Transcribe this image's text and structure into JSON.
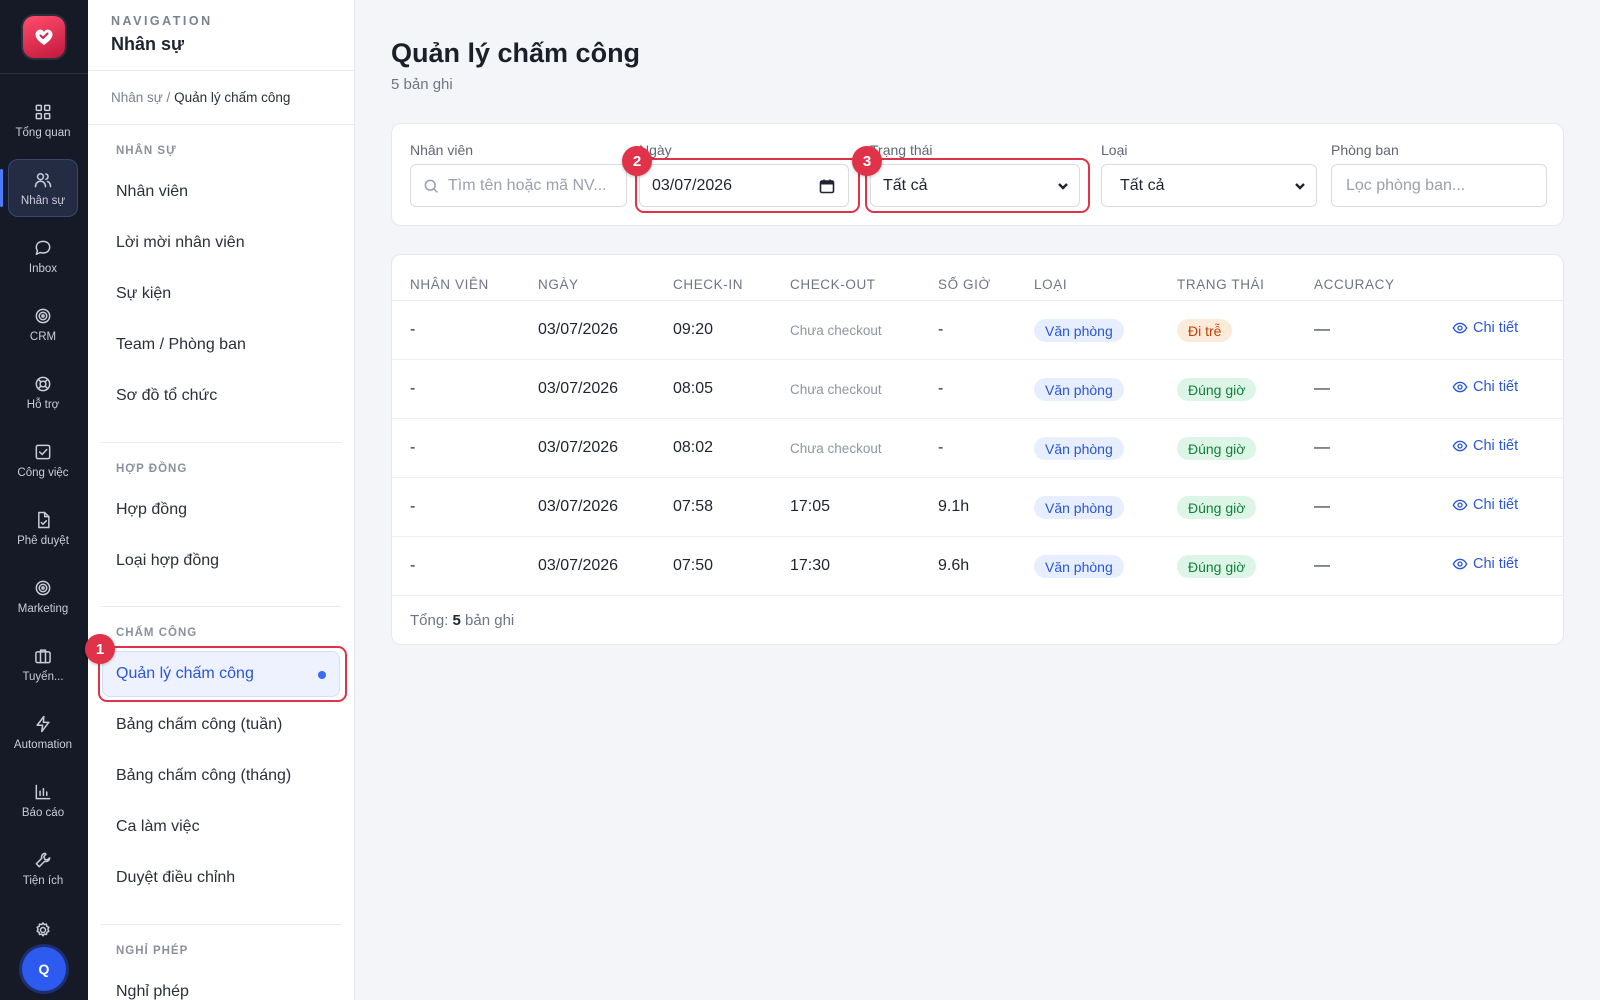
{
  "rail": {
    "avatar": "Q",
    "items": [
      {
        "label": "Tổng quan",
        "icon": "dashboard-grid-icon"
      },
      {
        "label": "Nhân sự",
        "icon": "users-icon",
        "active": true
      },
      {
        "label": "Inbox",
        "icon": "chat-bubble-icon"
      },
      {
        "label": "CRM",
        "icon": "target-icon"
      },
      {
        "label": "Hỗ trợ",
        "icon": "lifebuoy-icon"
      },
      {
        "label": "Công việc",
        "icon": "checkbox-icon"
      },
      {
        "label": "Phê duyệt",
        "icon": "file-check-icon"
      },
      {
        "label": "Marketing",
        "icon": "target-icon"
      },
      {
        "label": "Tuyển...",
        "icon": "briefcase-icon"
      },
      {
        "label": "Automation",
        "icon": "lightning-icon"
      },
      {
        "label": "Báo cáo",
        "icon": "bar-chart-icon"
      },
      {
        "label": "Tiện ích",
        "icon": "wrench-icon"
      }
    ]
  },
  "sidebar": {
    "eyebrow": "NAVIGATION",
    "title": "Nhân sự",
    "breadcrumb_parent": "Nhân sự /",
    "breadcrumb_current": "Quản lý chấm công",
    "sections": [
      {
        "heading": "NHÂN SỰ",
        "items": [
          "Nhân viên",
          "Lời mời nhân viên",
          "Sự kiện",
          "Team / Phòng ban",
          "Sơ đồ tổ chức"
        ]
      },
      {
        "heading": "HỢP ĐỒNG",
        "items": [
          "Hợp đồng",
          "Loại hợp đồng"
        ]
      },
      {
        "heading": "CHẤM CÔNG",
        "items": [
          "Quản lý chấm công",
          "Bảng chấm công (tuần)",
          "Bảng chấm công (tháng)",
          "Ca làm việc",
          "Duyệt điều chỉnh"
        ]
      },
      {
        "heading": "NGHỈ PHÉP",
        "items": [
          "Nghỉ phép"
        ]
      }
    ]
  },
  "callouts": [
    "1",
    "2",
    "3"
  ],
  "page": {
    "title": "Quản lý chấm công",
    "subtitle": "5 bản ghi"
  },
  "filters": {
    "employee_label": "Nhân viên",
    "employee_placeholder": "Tìm tên hoặc mã NV...",
    "date_label": "Ngày",
    "date_value": "03/07/2026",
    "status_label": "Trạng thái",
    "status_value": "Tất cả",
    "type_label": "Loại",
    "type_value": "Tất cả",
    "dept_label": "Phòng ban",
    "dept_placeholder": "Lọc phòng ban..."
  },
  "table": {
    "headers": [
      "NHÂN VIÊN",
      "NGÀY",
      "CHECK-IN",
      "CHECK-OUT",
      "SỐ GIỜ",
      "LOẠI",
      "TRẠNG THÁI",
      "ACCURACY"
    ],
    "detail_label": "Chi tiết",
    "rows": [
      {
        "employee": "-",
        "date": "03/07/2026",
        "checkin": "09:20",
        "checkout": "Chưa checkout",
        "hours": "-",
        "type": "Văn phòng",
        "status": "Đi trễ",
        "status_color": "orange",
        "accuracy": "—"
      },
      {
        "employee": "-",
        "date": "03/07/2026",
        "checkin": "08:05",
        "checkout": "Chưa checkout",
        "hours": "-",
        "type": "Văn phòng",
        "status": "Đúng giờ",
        "status_color": "green",
        "accuracy": "—"
      },
      {
        "employee": "-",
        "date": "03/07/2026",
        "checkin": "08:02",
        "checkout": "Chưa checkout",
        "hours": "-",
        "type": "Văn phòng",
        "status": "Đúng giờ",
        "status_color": "green",
        "accuracy": "—"
      },
      {
        "employee": "-",
        "date": "03/07/2026",
        "checkin": "07:58",
        "checkout": "17:05",
        "hours": "9.1h",
        "type": "Văn phòng",
        "status": "Đúng giờ",
        "status_color": "green",
        "accuracy": "—"
      },
      {
        "employee": "-",
        "date": "03/07/2026",
        "checkin": "07:50",
        "checkout": "17:30",
        "hours": "9.6h",
        "type": "Văn phòng",
        "status": "Đúng giờ",
        "status_color": "green",
        "accuracy": "—"
      }
    ],
    "footer_prefix": "Tổng:",
    "footer_count": "5",
    "footer_suffix": "bản ghi"
  }
}
